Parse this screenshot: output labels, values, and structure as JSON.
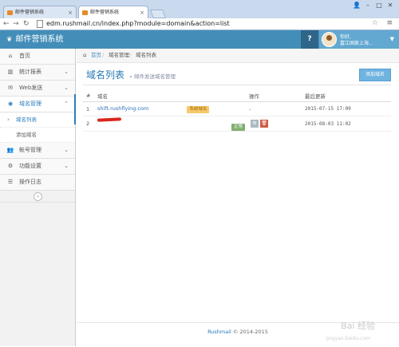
{
  "browser": {
    "tabs": [
      {
        "label": "邮件营销系统",
        "active": false
      },
      {
        "label": "邮件营销系统",
        "active": true
      }
    ],
    "url": "edm.rushmail.cn/index.php?module=domain&action=list"
  },
  "header": {
    "brand": "邮件营销系统",
    "help": "?",
    "welcome": "你好,",
    "username": "富江国家上海..."
  },
  "sidebar": {
    "items": [
      {
        "icon": "home-icon",
        "label": "首页"
      },
      {
        "icon": "chart-icon",
        "label": "统计报表"
      },
      {
        "icon": "envelope-icon",
        "label": "Web发送"
      },
      {
        "icon": "globe-icon",
        "label": "域名管理"
      },
      {
        "icon": "users-icon",
        "label": "帐号管理"
      },
      {
        "icon": "cogs-icon",
        "label": "功能设置"
      },
      {
        "icon": "list-icon",
        "label": "操作日志"
      }
    ],
    "subitems": [
      {
        "label": "域名列表"
      },
      {
        "label": "添加域名"
      }
    ]
  },
  "breadcrumb": {
    "home": "首页",
    "level2": "域名管理",
    "level3": "域名列表",
    "sep": "/"
  },
  "page": {
    "title": "域名列表",
    "subtitle": "» 邮件发送域名管理",
    "add_button": "添加域名"
  },
  "table": {
    "headers": [
      "#",
      "域名",
      "操作",
      "最后更新"
    ],
    "rows": [
      {
        "idx": "1",
        "domain": "shift.rushflying.com",
        "tag": "系统域名",
        "op": "-",
        "updated": "2015-07-15 17:09"
      },
      {
        "idx": "2",
        "domain": "",
        "tag": "正常",
        "op": "",
        "updated": "2015-08-03 11:02"
      }
    ]
  },
  "footer": {
    "brand": "Rushmail",
    "copy": "© 2014-2015"
  },
  "watermark": "Bai 经验",
  "watermark_sub": "jingyan.baidu.com"
}
